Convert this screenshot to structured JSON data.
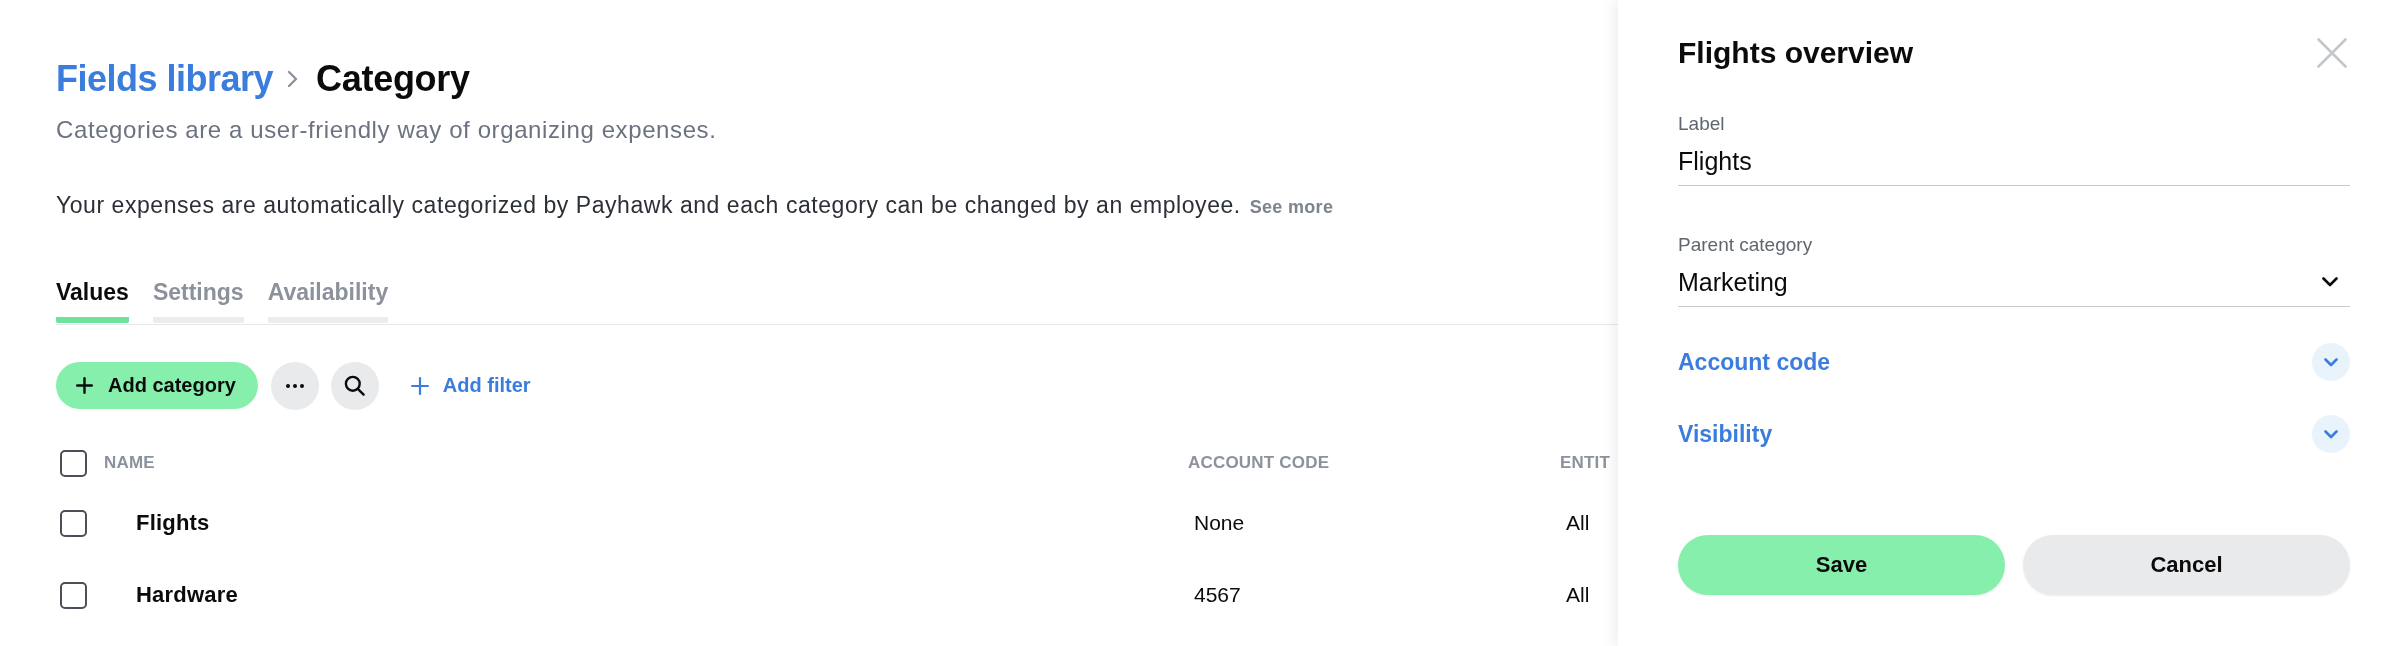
{
  "breadcrumb": {
    "parent": "Fields library",
    "current": "Category"
  },
  "subtitle": "Categories are a user-friendly way of organizing expenses.",
  "description": {
    "text": "Your expenses are automatically categorized by Payhawk and each category can be changed by an employee.",
    "link": "See more"
  },
  "tabs": [
    {
      "label": "Values",
      "selected": true
    },
    {
      "label": "Settings",
      "selected": false
    },
    {
      "label": "Availability",
      "selected": false
    }
  ],
  "toolbar": {
    "add_button": "Add category",
    "filter_button": "Add filter"
  },
  "table": {
    "select_all": {
      "checked": false
    },
    "columns": [
      "NAME",
      "ACCOUNT CODE",
      "ENTIT"
    ],
    "rows": [
      {
        "checked": false,
        "cells": [
          "Flights",
          "None",
          "All"
        ]
      },
      {
        "checked": false,
        "cells": [
          "Hardware",
          "4567",
          "All"
        ]
      }
    ]
  },
  "panel": {
    "title": "Flights overview",
    "fields": [
      {
        "kind": "text",
        "label": "Label",
        "value": "Flights"
      },
      {
        "kind": "select",
        "label": "Parent category",
        "value": "Marketing"
      }
    ],
    "sections": [
      {
        "title": "Account code",
        "expanded": false
      },
      {
        "title": "Visibility",
        "expanded": false
      }
    ],
    "buttons": [
      {
        "kind": "primary",
        "label": "Save"
      },
      {
        "kind": "secondary",
        "label": "Cancel"
      }
    ]
  }
}
